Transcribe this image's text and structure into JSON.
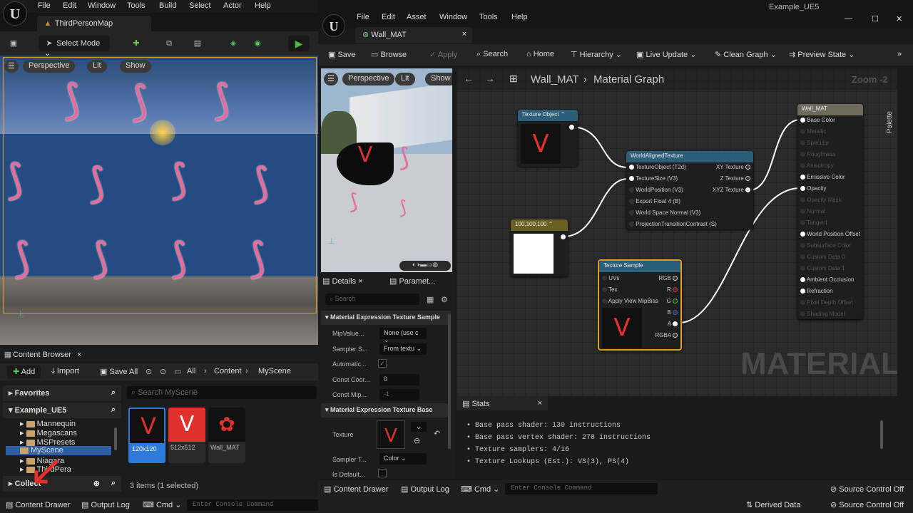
{
  "main": {
    "menu": [
      "File",
      "Edit",
      "Window",
      "Tools",
      "Build",
      "Select",
      "Actor",
      "Help"
    ],
    "tab": "ThirdPersonMap",
    "select_mode": "Select Mode",
    "viewport": {
      "perspective": "Perspective",
      "lit": "Lit",
      "show": "Show"
    }
  },
  "content_browser": {
    "title": "Content Browser",
    "add": "Add",
    "import": "Import",
    "save_all": "Save All",
    "breadcrumb": [
      "All",
      "Content",
      "MyScene"
    ],
    "favorites": "Favorites",
    "project": "Example_UE5",
    "search_placeholder": "Search MyScene",
    "folders": [
      "Mannequin",
      "Megascans",
      "MSPresets",
      "MyScene",
      "Niagara",
      "ThirdPera"
    ],
    "collections": "Collect",
    "assets": [
      {
        "label": "120x120"
      },
      {
        "label": "512x512"
      },
      {
        "label": "Wall_MAT"
      }
    ],
    "status": "3 items (1 selected)"
  },
  "bottom_bar": {
    "content_drawer": "Content Drawer",
    "output_log": "Output Log",
    "cmd": "Cmd",
    "console_placeholder": "Enter Console Command",
    "derived_data": "Derived Data",
    "source_control": "Source Control Off"
  },
  "material_editor": {
    "window_title": "Example_UE5",
    "menu": [
      "File",
      "Edit",
      "Asset",
      "Window",
      "Tools",
      "Help"
    ],
    "tab": "Wall_MAT",
    "toolbar": {
      "save": "Save",
      "browse": "Browse",
      "apply": "Apply",
      "search": "Search",
      "home": "Home",
      "hierarchy": "Hierarchy",
      "live_update": "Live Update",
      "clean_graph": "Clean Graph",
      "preview_state": "Preview State"
    },
    "preview": {
      "perspective": "Perspective",
      "lit": "Lit",
      "show": "Show"
    },
    "details": {
      "tab_details": "Details",
      "tab_params": "Paramet...",
      "search_placeholder": "Search",
      "section1": "Material Expression Texture Sample",
      "rows1": [
        {
          "label": "MipValue...",
          "value": "None (use c"
        },
        {
          "label": "Sampler S...",
          "value": "From textu"
        },
        {
          "label": "Automatic...",
          "value": ""
        },
        {
          "label": "Const Coor...",
          "value": "0"
        },
        {
          "label": "Const Mip...",
          "value": "-1"
        }
      ],
      "section2": "Material Expression Texture Base",
      "texture_label": "Texture",
      "sampler_type_label": "Sampler T...",
      "sampler_type_value": "Color",
      "is_default_label": "Is Default..."
    },
    "graph": {
      "breadcrumb_asset": "Wall_MAT",
      "breadcrumb_graph": "Material Graph",
      "zoom": "Zoom -2",
      "palette": "Palette",
      "watermark": "MATERIAL",
      "texture_object_node": "Texture Object",
      "constant_node": "100,100,100",
      "wat_node": {
        "title": "WorldAlignedTexture",
        "inputs": [
          "TextureObject (T2d)",
          "TextureSize (V3)",
          "WorldPosition (V3)",
          "Export Float 4 (B)",
          "World Space Normal (V3)",
          "ProjectionTransitionContrast (S)"
        ],
        "outputs": [
          "XY Texture",
          "Z Texture",
          "XYZ Texture"
        ]
      },
      "texsample_node": {
        "title": "Texture Sample",
        "inputs": [
          "UVs",
          "Tex",
          "Apply View MipBias"
        ],
        "outputs": [
          "RGB",
          "R",
          "G",
          "B",
          "A",
          "RGBA"
        ]
      },
      "result_node": {
        "title": "Wall_MAT",
        "pins": [
          "Base Color",
          "Metallic",
          "Specular",
          "Roughness",
          "Anisotropy",
          "Emissive Color",
          "Opacity",
          "Opacity Mask",
          "Normal",
          "Tangent",
          "World Position Offset",
          "Subsurface Color",
          "Custom Data 0",
          "Custom Data 1",
          "Ambient Occlusion",
          "Refraction",
          "Pixel Depth Offset",
          "Shading Model"
        ],
        "active": [
          "Base Color",
          "Emissive Color",
          "Opacity",
          "World Position Offset",
          "Ambient Occlusion",
          "Refraction"
        ]
      }
    },
    "stats": {
      "title": "Stats",
      "lines": [
        "Base pass shader: 130 instructions",
        "Base pass vertex shader: 278 instructions",
        "Texture samplers: 4/16",
        "Texture Lookups (Est.): VS(3), PS(4)"
      ]
    },
    "bottom": {
      "content_drawer": "Content Drawer",
      "output_log": "Output Log",
      "cmd": "Cmd",
      "console_placeholder": "Enter Console Command",
      "source_control": "Source Control Off"
    }
  }
}
